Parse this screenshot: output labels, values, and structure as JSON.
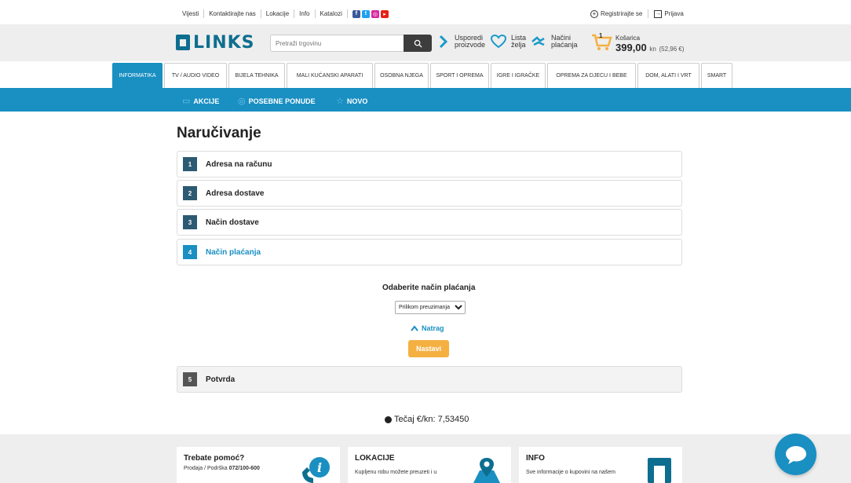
{
  "top": {
    "links": [
      "Vijesti",
      "Kontaktirajte nas",
      "Lokacije",
      "Info",
      "Katalozi"
    ],
    "register": "Registrirajte se",
    "login": "Prijava"
  },
  "header": {
    "logo": "LINKS",
    "search_placeholder": "Pretraži trgovinu",
    "compare_1": "Usporedi",
    "compare_2": "proizvode",
    "wishlist_1": "Lista",
    "wishlist_2": "želja",
    "payment_1": "Načini",
    "payment_2": "plaćanja",
    "cart_count": "1",
    "cart_label": "Košarica",
    "cart_amount": "399,00",
    "cart_currency": "kn",
    "cart_eur": "(52,96 €)"
  },
  "categories": [
    "INFORMATIKA",
    "TV / AUDIO VIDEO",
    "BIJELA TEHNIKA",
    "MALI KUĆANSKI APARATI",
    "OSOBNA NJEGA",
    "SPORT I OPREMA",
    "IGRE I IGRAČKE",
    "OPREMA ZA DJECU I BEBE",
    "DOM, ALATI I VRT",
    "SMART"
  ],
  "promos": [
    "AKCIJE",
    "POSEBNE PONUDE",
    "NOVO"
  ],
  "page": {
    "title": "Naručivanje",
    "steps": [
      {
        "num": "1",
        "label": "Adresa na računu"
      },
      {
        "num": "2",
        "label": "Adresa dostave"
      },
      {
        "num": "3",
        "label": "Način dostave"
      },
      {
        "num": "4",
        "label": "Način plaćanja"
      },
      {
        "num": "5",
        "label": "Potvrda"
      }
    ],
    "choose_payment": "Odaberite način plaćanja",
    "payment_option": "Prilikom preuzimanja",
    "back": "Natrag",
    "continue": "Nastavi",
    "rate": "Tečaj €/kn: 7,53450"
  },
  "footer": {
    "help_title": "Trebate pomoć?",
    "help_text_prefix": "Prodaja / Podrška ",
    "help_phone": "072/100-600",
    "loc_title": "LOKACIJE",
    "loc_text": "Kupljenu robu možete preuzeti i u",
    "info_title": "INFO",
    "info_text": "Sve informacije o kupovini na našem"
  }
}
